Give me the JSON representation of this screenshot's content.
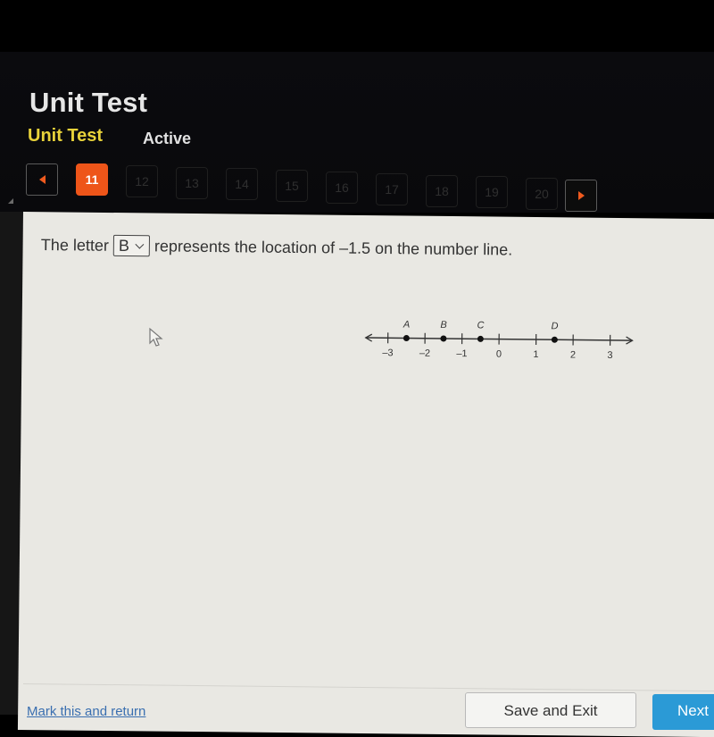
{
  "header": {
    "title": "Unit Test",
    "subtitle": "Unit Test",
    "status": "Active"
  },
  "navigation": {
    "prev_icon": "left-triangle-icon",
    "next_icon": "right-triangle-icon",
    "questions": [
      "11",
      "12",
      "13",
      "14",
      "15",
      "16",
      "17",
      "18",
      "19",
      "20"
    ],
    "current": "11"
  },
  "question": {
    "text_before": "The letter",
    "dropdown_value": "B",
    "text_after": "represents the location of –1.5 on the number line."
  },
  "number_line": {
    "tick_labels": [
      "–3",
      "–2",
      "–1",
      "0",
      "1",
      "2",
      "3"
    ],
    "ticks": [
      -3,
      -2,
      -1,
      0,
      1,
      2,
      3
    ],
    "range": [
      -3.6,
      3.6
    ],
    "points": [
      {
        "label": "A",
        "value": -2.5
      },
      {
        "label": "B",
        "value": -1.5
      },
      {
        "label": "C",
        "value": -0.5
      },
      {
        "label": "D",
        "value": 1.5
      }
    ]
  },
  "footer": {
    "mark_link": "Mark this and return",
    "save_exit": "Save and Exit",
    "next": "Next"
  },
  "colors": {
    "accent_orange": "#ee5519",
    "subtitle_yellow": "#e8d23a",
    "next_blue": "#2b9ad6"
  }
}
